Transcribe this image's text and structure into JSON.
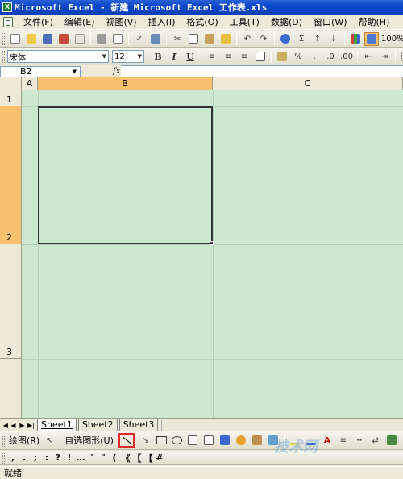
{
  "window": {
    "title": "Microsoft Excel - 新建 Microsoft Excel 工作表.xls",
    "icon_letter": "X"
  },
  "menu": [
    "文件(F)",
    "编辑(E)",
    "视图(V)",
    "插入(I)",
    "格式(O)",
    "工具(T)",
    "数据(D)",
    "窗口(W)",
    "帮助(H)"
  ],
  "standard_toolbar": {
    "zoom": "100%"
  },
  "formatting_toolbar": {
    "font": "宋体",
    "size": "12",
    "bold": "B",
    "italic": "I",
    "underline": "U",
    "percent": "%"
  },
  "formula_bar": {
    "name_box": "B2",
    "fx": "fx",
    "value": ""
  },
  "columns": [
    "A",
    "B",
    "C"
  ],
  "rows": [
    "1",
    "2",
    "3"
  ],
  "selected_cell": "B2",
  "sheets": [
    "Sheet1",
    "Sheet2",
    "Sheet3"
  ],
  "active_sheet": "Sheet1",
  "drawing_toolbar": {
    "draw_label": "绘图(R)",
    "autoshapes_label": "自选图形(U)"
  },
  "symbol_toolbar": {
    "symbols": [
      ",",
      ".",
      ";",
      ":",
      "?",
      "!",
      "…",
      "'",
      "\"",
      "(",
      "《",
      "〖",
      "【",
      "#"
    ]
  },
  "status": {
    "text": "就绪"
  },
  "watermark": {
    "text": "技术网"
  },
  "colors": {
    "grid_bg": "#cce8cf",
    "selected_header": "#f9c06e",
    "highlight_box": "#e42a2a"
  }
}
